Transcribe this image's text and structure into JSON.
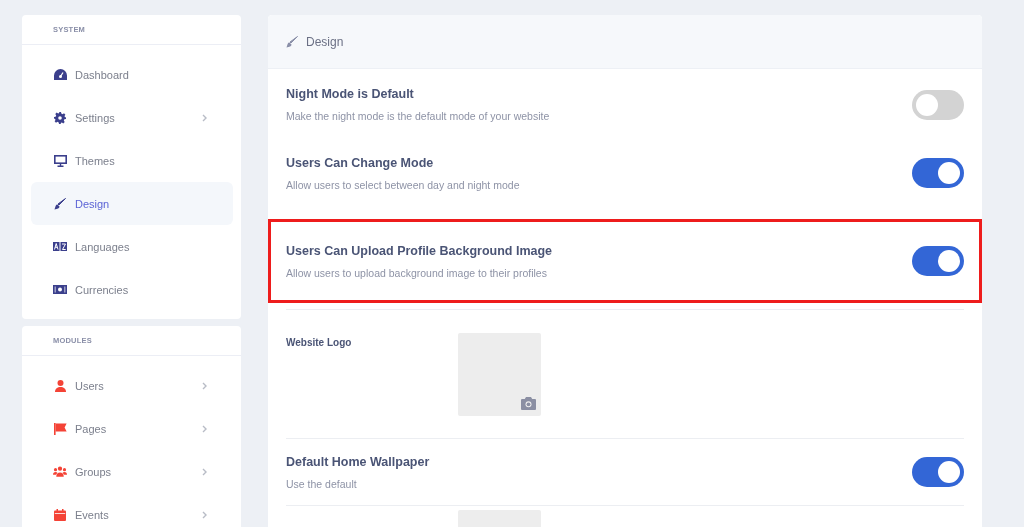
{
  "sidebar": {
    "sections": [
      {
        "title": "SYSTEM",
        "items": [
          {
            "label": "Dashboard",
            "selected": false,
            "has_submenu": false
          },
          {
            "label": "Settings",
            "selected": false,
            "has_submenu": true
          },
          {
            "label": "Themes",
            "selected": false,
            "has_submenu": false
          },
          {
            "label": "Design",
            "selected": true,
            "has_submenu": false
          },
          {
            "label": "Languages",
            "selected": false,
            "has_submenu": false
          },
          {
            "label": "Currencies",
            "selected": false,
            "has_submenu": false
          }
        ]
      },
      {
        "title": "MODULES",
        "items": [
          {
            "label": "Users",
            "selected": false,
            "has_submenu": true
          },
          {
            "label": "Pages",
            "selected": false,
            "has_submenu": true
          },
          {
            "label": "Groups",
            "selected": false,
            "has_submenu": true
          },
          {
            "label": "Events",
            "selected": false,
            "has_submenu": true
          }
        ]
      }
    ]
  },
  "panel": {
    "title": "Design",
    "settings": [
      {
        "kind": "toggle",
        "title": "Night Mode is Default",
        "description": "Make the night mode is the default mode of your website",
        "on": false,
        "highlighted": false
      },
      {
        "kind": "toggle",
        "title": "Users Can Change Mode",
        "description": "Allow users to select between day and night mode",
        "on": true,
        "highlighted": false
      },
      {
        "kind": "toggle",
        "title": "Users Can Upload Profile Background Image",
        "description": "Allow users to upload background image to their profiles",
        "on": true,
        "highlighted": true
      },
      {
        "kind": "image",
        "title": "Website Logo"
      },
      {
        "kind": "toggle",
        "title": "Default Home Wallpaper",
        "description": "Use the default",
        "on": true,
        "highlighted": false
      },
      {
        "kind": "image"
      }
    ]
  }
}
